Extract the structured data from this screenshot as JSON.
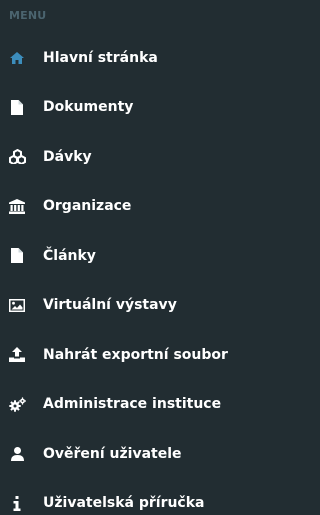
{
  "menu": {
    "header": "MENU",
    "items": [
      {
        "label": "Hlavní stránka",
        "icon": "home-icon",
        "icon_color": "#3c8dbc"
      },
      {
        "label": "Dokumenty",
        "icon": "file-icon",
        "icon_color": "#ffffff"
      },
      {
        "label": "Dávky",
        "icon": "cubes-icon",
        "icon_color": "#ffffff"
      },
      {
        "label": "Organizace",
        "icon": "institution-icon",
        "icon_color": "#ffffff"
      },
      {
        "label": "Články",
        "icon": "file-icon",
        "icon_color": "#ffffff"
      },
      {
        "label": "Virtuální výstavy",
        "icon": "image-icon",
        "icon_color": "#ffffff"
      },
      {
        "label": "Nahrát exportní soubor",
        "icon": "upload-icon",
        "icon_color": "#ffffff"
      },
      {
        "label": "Administrace instituce",
        "icon": "cogs-icon",
        "icon_color": "#ffffff"
      },
      {
        "label": "Ověření uživatele",
        "icon": "user-icon",
        "icon_color": "#ffffff"
      },
      {
        "label": "Uživatelská příručka",
        "icon": "info-icon",
        "icon_color": "#ffffff"
      }
    ]
  },
  "colors": {
    "background": "#222d32",
    "header_text": "#4b646f",
    "item_text": "#ffffff",
    "accent": "#3c8dbc"
  }
}
